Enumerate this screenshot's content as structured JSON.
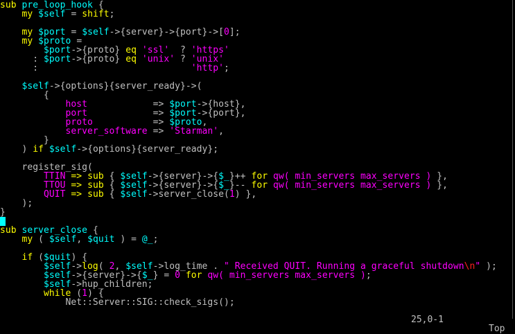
{
  "colors": {
    "keyword": "#ffff00",
    "identifier": "#00ffff",
    "text": "#c0c0c0",
    "constant": "#ff00ff",
    "special": "#ff2020",
    "background": "#000000"
  },
  "cursor_line": 24,
  "lines": [
    [
      [
        "y",
        "sub"
      ],
      [
        "w",
        " "
      ],
      [
        "c",
        "pre_loop_hook"
      ],
      [
        "w",
        " {"
      ]
    ],
    [
      [
        "w",
        "    "
      ],
      [
        "y",
        "my"
      ],
      [
        "w",
        " "
      ],
      [
        "c",
        "$self"
      ],
      [
        "w",
        " = "
      ],
      [
        "y",
        "shift"
      ],
      [
        "w",
        ";"
      ]
    ],
    [],
    [
      [
        "w",
        "    "
      ],
      [
        "y",
        "my"
      ],
      [
        "w",
        " "
      ],
      [
        "c",
        "$port"
      ],
      [
        "w",
        " = "
      ],
      [
        "c",
        "$self"
      ],
      [
        "w",
        "->{server}->{port}->["
      ],
      [
        "m",
        "0"
      ],
      [
        "w",
        "];"
      ]
    ],
    [
      [
        "w",
        "    "
      ],
      [
        "y",
        "my"
      ],
      [
        "w",
        " "
      ],
      [
        "c",
        "$proto"
      ],
      [
        "w",
        " ="
      ]
    ],
    [
      [
        "w",
        "        "
      ],
      [
        "c",
        "$port"
      ],
      [
        "w",
        "->{proto} "
      ],
      [
        "y",
        "eq"
      ],
      [
        "w",
        " "
      ],
      [
        "m",
        "'ssl'"
      ],
      [
        "w",
        "  ? "
      ],
      [
        "m",
        "'https'"
      ]
    ],
    [
      [
        "w",
        "      : "
      ],
      [
        "c",
        "$port"
      ],
      [
        "w",
        "->{proto} "
      ],
      [
        "y",
        "eq"
      ],
      [
        "w",
        " "
      ],
      [
        "m",
        "'unix'"
      ],
      [
        "w",
        " ? "
      ],
      [
        "m",
        "'unix'"
      ]
    ],
    [
      [
        "w",
        "      :                            "
      ],
      [
        "m",
        "'http'"
      ],
      [
        "w",
        ";"
      ]
    ],
    [],
    [
      [
        "w",
        "    "
      ],
      [
        "c",
        "$self"
      ],
      [
        "w",
        "->{options}{server_ready}->("
      ]
    ],
    [
      [
        "w",
        "        {"
      ]
    ],
    [
      [
        "w",
        "            "
      ],
      [
        "m",
        "host"
      ],
      [
        "w",
        "            => "
      ],
      [
        "c",
        "$port"
      ],
      [
        "w",
        "->{host},"
      ]
    ],
    [
      [
        "w",
        "            "
      ],
      [
        "m",
        "port"
      ],
      [
        "w",
        "            => "
      ],
      [
        "c",
        "$port"
      ],
      [
        "w",
        "->{port},"
      ]
    ],
    [
      [
        "w",
        "            "
      ],
      [
        "m",
        "proto"
      ],
      [
        "w",
        "           => "
      ],
      [
        "c",
        "$proto"
      ],
      [
        "w",
        ","
      ]
    ],
    [
      [
        "w",
        "            "
      ],
      [
        "m",
        "server_software"
      ],
      [
        "w",
        " => "
      ],
      [
        "m",
        "'Starman'"
      ],
      [
        "w",
        ","
      ]
    ],
    [
      [
        "w",
        "        }"
      ]
    ],
    [
      [
        "w",
        "    ) "
      ],
      [
        "y",
        "if"
      ],
      [
        "w",
        " "
      ],
      [
        "c",
        "$self"
      ],
      [
        "w",
        "->{options}{server_ready};"
      ]
    ],
    [],
    [
      [
        "w",
        "    register_sig("
      ]
    ],
    [
      [
        "w",
        "        "
      ],
      [
        "m",
        "TTIN"
      ],
      [
        "w",
        " "
      ],
      [
        "y",
        "=>"
      ],
      [
        "w",
        " "
      ],
      [
        "y",
        "sub"
      ],
      [
        "w",
        " { "
      ],
      [
        "c",
        "$self"
      ],
      [
        "w",
        "->{server}->{"
      ],
      [
        "c",
        "$_"
      ],
      [
        "w",
        "}++ "
      ],
      [
        "y",
        "for"
      ],
      [
        "w",
        " "
      ],
      [
        "m",
        "qw( min_servers max_servers )"
      ],
      [
        "w",
        " },"
      ]
    ],
    [
      [
        "w",
        "        "
      ],
      [
        "m",
        "TTOU"
      ],
      [
        "w",
        " "
      ],
      [
        "y",
        "=>"
      ],
      [
        "w",
        " "
      ],
      [
        "y",
        "sub"
      ],
      [
        "w",
        " { "
      ],
      [
        "c",
        "$self"
      ],
      [
        "w",
        "->{server}->{"
      ],
      [
        "c",
        "$_"
      ],
      [
        "w",
        "}-- "
      ],
      [
        "y",
        "for"
      ],
      [
        "w",
        " "
      ],
      [
        "m",
        "qw( min_servers max_servers )"
      ],
      [
        "w",
        " },"
      ]
    ],
    [
      [
        "w",
        "        "
      ],
      [
        "m",
        "QUIT"
      ],
      [
        "w",
        " "
      ],
      [
        "y",
        "=>"
      ],
      [
        "w",
        " "
      ],
      [
        "y",
        "sub"
      ],
      [
        "w",
        " { "
      ],
      [
        "c",
        "$self"
      ],
      [
        "w",
        "->server_close("
      ],
      [
        "m",
        "1"
      ],
      [
        "w",
        ") },"
      ]
    ],
    [
      [
        "w",
        "    );"
      ]
    ],
    [
      [
        "w",
        "}"
      ]
    ],
    [],
    [
      [
        "y",
        "sub"
      ],
      [
        "w",
        " "
      ],
      [
        "c",
        "server_close"
      ],
      [
        "w",
        " {"
      ]
    ],
    [
      [
        "w",
        "    "
      ],
      [
        "y",
        "my"
      ],
      [
        "w",
        " ( "
      ],
      [
        "c",
        "$self"
      ],
      [
        "w",
        ", "
      ],
      [
        "c",
        "$quit"
      ],
      [
        "w",
        " ) = "
      ],
      [
        "c",
        "@_"
      ],
      [
        "w",
        ";"
      ]
    ],
    [],
    [
      [
        "w",
        "    "
      ],
      [
        "y",
        "if"
      ],
      [
        "w",
        " ("
      ],
      [
        "c",
        "$quit"
      ],
      [
        "w",
        ") {"
      ]
    ],
    [
      [
        "w",
        "        "
      ],
      [
        "c",
        "$self"
      ],
      [
        "w",
        "->"
      ],
      [
        "y",
        "log"
      ],
      [
        "w",
        "( "
      ],
      [
        "m",
        "2"
      ],
      [
        "w",
        ", "
      ],
      [
        "c",
        "$self"
      ],
      [
        "w",
        "->log_time . "
      ],
      [
        "m",
        "\" Received QUIT. Running a graceful shutdown"
      ],
      [
        "r",
        "\\n"
      ],
      [
        "m",
        "\""
      ],
      [
        "w",
        " );"
      ]
    ],
    [
      [
        "w",
        "        "
      ],
      [
        "c",
        "$self"
      ],
      [
        "w",
        "->{server}->{"
      ],
      [
        "c",
        "$_"
      ],
      [
        "w",
        "} = "
      ],
      [
        "m",
        "0"
      ],
      [
        "w",
        " "
      ],
      [
        "y",
        "for"
      ],
      [
        "w",
        " "
      ],
      [
        "m",
        "qw( min_servers max_servers )"
      ],
      [
        "w",
        ";"
      ]
    ],
    [
      [
        "w",
        "        "
      ],
      [
        "c",
        "$self"
      ],
      [
        "w",
        "->hup_children;"
      ]
    ],
    [
      [
        "w",
        "        "
      ],
      [
        "y",
        "while"
      ],
      [
        "w",
        " ("
      ],
      [
        "m",
        "1"
      ],
      [
        "w",
        ") {"
      ]
    ],
    [
      [
        "w",
        "            Net::Server::SIG::check_sigs();"
      ]
    ]
  ],
  "status": {
    "position": "25,0-1",
    "scroll": "Top"
  }
}
